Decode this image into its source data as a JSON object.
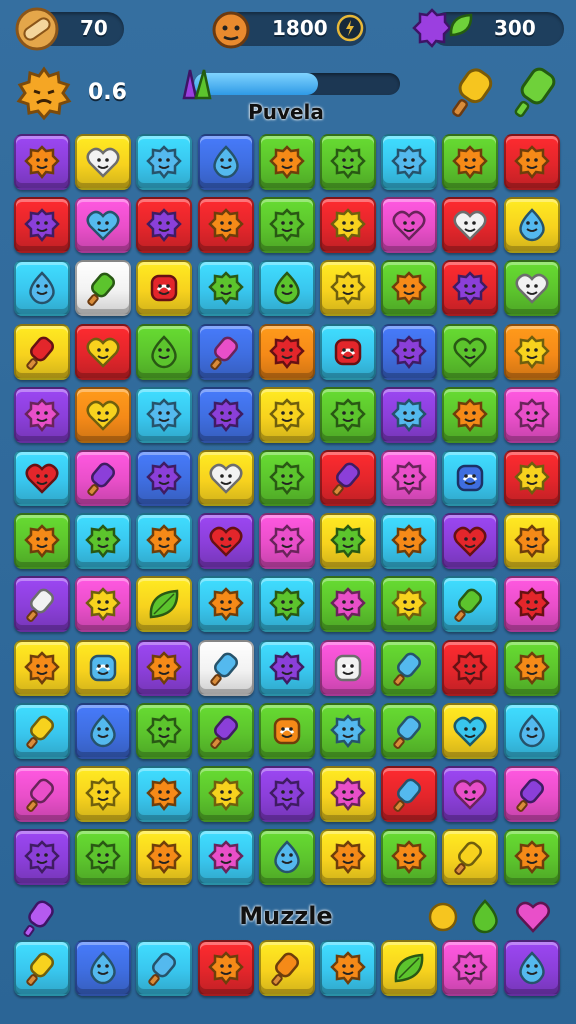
{
  "hud": {
    "coins_value": "70",
    "score_value": "1800",
    "gems_value": "300",
    "level_value": "0.6",
    "progress": 0.6,
    "board_title": "Puvela",
    "tray_title": "Muzzle",
    "icons": {
      "coin": "bandage-coin-icon",
      "score": "fox-face-icon",
      "score_action": "bolt-icon",
      "gems": "purple-blob-icon",
      "gems_extra": "green-leaf-icon",
      "level": "orange-sun-face-icon",
      "progress_candy": "candy-icon",
      "popsicle": "popsicle-icon",
      "green_popsicle": "green-popsicle-icon",
      "tray_left": "purple-popsicle-icon",
      "tray_orange": "orange-candy-icon",
      "tray_green": "green-drop-icon",
      "tray_heart": "pink-heart-icon"
    }
  },
  "palette": {
    "purple": "#8b3fd9",
    "yellow": "#f7d21e",
    "cyan": "#39c6ee",
    "blue": "#3f6ee0",
    "green": "#5cc42d",
    "red": "#e3262b",
    "pink": "#e94fc9",
    "orange": "#f58a18",
    "white": "#f2f2f2",
    "lightblue": "#54b9ee"
  },
  "board": {
    "rows": [
      [
        [
          "purple",
          "blob",
          "orange"
        ],
        [
          "yellow",
          "heart",
          "white"
        ],
        [
          "cyan",
          "blob",
          "lightblue"
        ],
        [
          "blue",
          "drop",
          "lightblue"
        ],
        [
          "green",
          "blob",
          "orange"
        ],
        [
          "green",
          "blob",
          "green"
        ],
        [
          "cyan",
          "blob",
          "lightblue"
        ],
        [
          "green",
          "blob",
          "orange"
        ],
        [
          "red",
          "blob",
          "orange"
        ]
      ],
      [
        [
          "red",
          "blob",
          "purple"
        ],
        [
          "pink",
          "heart",
          "lightblue"
        ],
        [
          "red",
          "blob",
          "purple"
        ],
        [
          "red",
          "blob",
          "orange"
        ],
        [
          "green",
          "blob",
          "green"
        ],
        [
          "red",
          "blob",
          "yellow"
        ],
        [
          "pink",
          "heart",
          "pink"
        ],
        [
          "red",
          "heart",
          "white"
        ],
        [
          "yellow",
          "drop",
          "lightblue"
        ]
      ],
      [
        [
          "cyan",
          "drop",
          "lightblue"
        ],
        [
          "white",
          "popsicle",
          "green"
        ],
        [
          "yellow",
          "candy",
          "red"
        ],
        [
          "cyan",
          "blob",
          "green"
        ],
        [
          "cyan",
          "drop",
          "green"
        ],
        [
          "yellow",
          "blob",
          "yellow"
        ],
        [
          "green",
          "blob",
          "orange"
        ],
        [
          "red",
          "blob",
          "purple"
        ],
        [
          "green",
          "heart",
          "white"
        ]
      ],
      [
        [
          "yellow",
          "popsicle",
          "red"
        ],
        [
          "red",
          "heart",
          "yellow"
        ],
        [
          "green",
          "drop",
          "green"
        ],
        [
          "blue",
          "popsicle",
          "pink"
        ],
        [
          "orange",
          "blob",
          "red"
        ],
        [
          "cyan",
          "candy",
          "red"
        ],
        [
          "blue",
          "blob",
          "purple"
        ],
        [
          "green",
          "heart",
          "green"
        ],
        [
          "orange",
          "blob",
          "yellow"
        ]
      ],
      [
        [
          "purple",
          "blob",
          "pink"
        ],
        [
          "orange",
          "heart",
          "yellow"
        ],
        [
          "cyan",
          "blob",
          "lightblue"
        ],
        [
          "blue",
          "blob",
          "purple"
        ],
        [
          "yellow",
          "blob",
          "yellow"
        ],
        [
          "green",
          "blob",
          "green"
        ],
        [
          "purple",
          "blob",
          "lightblue"
        ],
        [
          "green",
          "blob",
          "orange"
        ],
        [
          "pink",
          "blob",
          "pink"
        ]
      ],
      [
        [
          "cyan",
          "heart",
          "red"
        ],
        [
          "pink",
          "popsicle",
          "purple"
        ],
        [
          "blue",
          "blob",
          "purple"
        ],
        [
          "yellow",
          "heart",
          "white"
        ],
        [
          "green",
          "blob",
          "green"
        ],
        [
          "red",
          "popsicle",
          "purple"
        ],
        [
          "pink",
          "blob",
          "pink"
        ],
        [
          "cyan",
          "candy",
          "blue"
        ],
        [
          "red",
          "blob",
          "yellow"
        ]
      ],
      [
        [
          "green",
          "blob",
          "orange"
        ],
        [
          "cyan",
          "blob",
          "green"
        ],
        [
          "cyan",
          "blob",
          "orange"
        ],
        [
          "purple",
          "heart",
          "red"
        ],
        [
          "pink",
          "blob",
          "pink"
        ],
        [
          "yellow",
          "blob",
          "green"
        ],
        [
          "cyan",
          "blob",
          "orange"
        ],
        [
          "purple",
          "heart",
          "red"
        ],
        [
          "yellow",
          "blob",
          "orange"
        ]
      ],
      [
        [
          "purple",
          "popsicle",
          "white"
        ],
        [
          "pink",
          "blob",
          "yellow"
        ],
        [
          "yellow",
          "leaf",
          "green"
        ],
        [
          "cyan",
          "blob",
          "orange"
        ],
        [
          "cyan",
          "blob",
          "green"
        ],
        [
          "green",
          "blob",
          "pink"
        ],
        [
          "green",
          "blob",
          "yellow"
        ],
        [
          "cyan",
          "popsicle",
          "green"
        ],
        [
          "pink",
          "blob",
          "red"
        ]
      ],
      [
        [
          "yellow",
          "blob",
          "orange"
        ],
        [
          "yellow",
          "candy",
          "lightblue"
        ],
        [
          "purple",
          "blob",
          "orange"
        ],
        [
          "white",
          "popsicle",
          "lightblue"
        ],
        [
          "cyan",
          "blob",
          "purple"
        ],
        [
          "pink",
          "candy",
          "white"
        ],
        [
          "green",
          "popsicle",
          "lightblue"
        ],
        [
          "red",
          "blob",
          "red"
        ],
        [
          "green",
          "blob",
          "orange"
        ]
      ],
      [
        [
          "cyan",
          "popsicle",
          "yellow"
        ],
        [
          "blue",
          "drop",
          "lightblue"
        ],
        [
          "green",
          "blob",
          "green"
        ],
        [
          "green",
          "popsicle",
          "purple"
        ],
        [
          "green",
          "candy",
          "orange"
        ],
        [
          "green",
          "blob",
          "lightblue"
        ],
        [
          "green",
          "popsicle",
          "lightblue"
        ],
        [
          "yellow",
          "heart",
          "cyan"
        ],
        [
          "cyan",
          "drop",
          "lightblue"
        ]
      ],
      [
        [
          "pink",
          "popsicle",
          "pink"
        ],
        [
          "yellow",
          "blob",
          "yellow"
        ],
        [
          "cyan",
          "blob",
          "orange"
        ],
        [
          "green",
          "blob",
          "yellow"
        ],
        [
          "purple",
          "blob",
          "purple"
        ],
        [
          "yellow",
          "blob",
          "pink"
        ],
        [
          "red",
          "popsicle",
          "lightblue"
        ],
        [
          "purple",
          "heart",
          "pink"
        ],
        [
          "pink",
          "popsicle",
          "purple"
        ]
      ],
      [
        [
          "purple",
          "blob",
          "purple"
        ],
        [
          "green",
          "blob",
          "green"
        ],
        [
          "yellow",
          "blob",
          "orange"
        ],
        [
          "cyan",
          "blob",
          "pink"
        ],
        [
          "green",
          "drop",
          "lightblue"
        ],
        [
          "yellow",
          "blob",
          "orange"
        ],
        [
          "green",
          "blob",
          "orange"
        ],
        [
          "yellow",
          "popsicle",
          "yellow"
        ],
        [
          "green",
          "blob",
          "orange"
        ]
      ]
    ]
  },
  "tray": {
    "tiles": [
      [
        "cyan",
        "popsicle",
        "yellow"
      ],
      [
        "blue",
        "drop",
        "lightblue"
      ],
      [
        "cyan",
        "popsicle",
        "lightblue"
      ],
      [
        "red",
        "blob",
        "orange"
      ],
      [
        "yellow",
        "popsicle",
        "orange"
      ],
      [
        "cyan",
        "blob",
        "orange"
      ],
      [
        "yellow",
        "leaf",
        "green"
      ],
      [
        "pink",
        "blob",
        "pink"
      ],
      [
        "purple",
        "drop",
        "lightblue"
      ]
    ]
  }
}
